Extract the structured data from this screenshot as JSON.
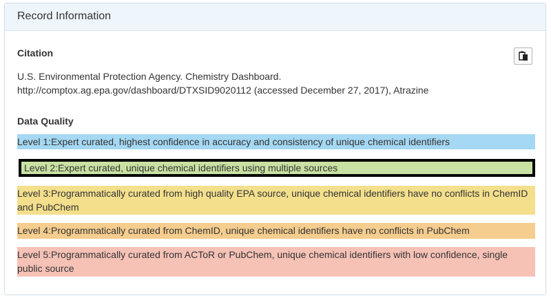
{
  "panel": {
    "title": "Record Information"
  },
  "citation": {
    "heading": "Citation",
    "line1": "U.S. Environmental Protection Agency. Chemistry Dashboard.",
    "line2": "http://comptox.ag.epa.gov/dashboard/DTXSID9020112 (accessed December 27, 2017), Atrazine",
    "copy_icon": "copy-clipboard-icon"
  },
  "data_quality": {
    "heading": "Data Quality",
    "levels": [
      {
        "text": "Level 1:Expert curated, highest confidence in accuracy and consistency of unique chemical identifiers",
        "color": "#a5d8f3",
        "selected": false
      },
      {
        "text": "Level 2:Expert curated, unique chemical identifiers using multiple sources",
        "color": "#c9e1a2",
        "selected": true
      },
      {
        "text": "Level 3:Programmatically curated from high quality EPA source, unique chemical identifiers have no conflicts in ChemID and PubChem",
        "color": "#f3df8c",
        "selected": false
      },
      {
        "text": "Level 4:Programmatically curated from ChemID, unique chemical identifiers have no conflicts in PubChem",
        "color": "#f5cd8e",
        "selected": false
      },
      {
        "text": "Level 5:Programmatically curated from ACToR or PubChem, unique chemical identifiers with low confidence, single public source",
        "color": "#f6c2b6",
        "selected": false
      }
    ]
  }
}
